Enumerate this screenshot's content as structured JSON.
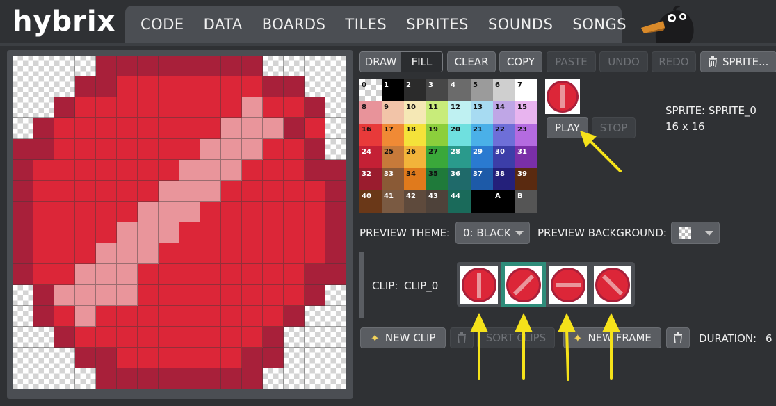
{
  "app": {
    "name": "hybrix"
  },
  "nav": {
    "tabs": [
      "CODE",
      "DATA",
      "BOARDS",
      "TILES",
      "SPRITES",
      "SOUNDS",
      "SONGS"
    ]
  },
  "toolbar": {
    "draw": "DRAW",
    "fill": "FILL",
    "clear": "CLEAR",
    "copy": "COPY",
    "paste": "PASTE",
    "undo": "UNDO",
    "redo": "REDO",
    "sprite_menu": "SPRITE..."
  },
  "palette": {
    "colors": [
      "#000000",
      "#000000",
      "#2b2b2b",
      "#474747",
      "#6b6b6b",
      "#9b9b9b",
      "#cfcfcf",
      "#ffffff",
      "#e8939a",
      "#f2c4a8",
      "#f5e8b5",
      "#c8ec7a",
      "#bff1f2",
      "#a7dbf2",
      "#bfa6e6",
      "#e8b4ef",
      "#e83a3a",
      "#f08a35",
      "#f4e23a",
      "#8ccf3c",
      "#6fe0df",
      "#4ab0e8",
      "#6e6fd8",
      "#b46be0",
      "#c42035",
      "#c77a3a",
      "#f2b43a",
      "#3aa83a",
      "#2a9a8c",
      "#2a7ad0",
      "#3c3ea8",
      "#7a2fa8",
      "#9a1c2e",
      "#8a5a36",
      "#e07a1c",
      "#1f7a3a",
      "#1f6a6a",
      "#1d5aa8",
      "#24207a",
      "#5a2a10",
      "#6a3818",
      "#7a5a42",
      "#5e4a3c",
      "#4e423a",
      "#1a6a5a",
      "#000000",
      "#000000",
      "#3a3a3a"
    ],
    "labels": [
      "0",
      "1",
      "2",
      "3",
      "4",
      "5",
      "6",
      "7",
      "8",
      "9",
      "10",
      "11",
      "12",
      "13",
      "14",
      "15",
      "16",
      "17",
      "18",
      "19",
      "20",
      "21",
      "22",
      "23",
      "24",
      "25",
      "26",
      "27",
      "28",
      "29",
      "30",
      "31",
      "32",
      "33",
      "34",
      "35",
      "36",
      "37",
      "38",
      "39",
      "40",
      "41",
      "42",
      "43",
      "44",
      "",
      "A",
      "B"
    ]
  },
  "sprite": {
    "play": "PLAY",
    "stop": "STOP",
    "name": "SPRITE: SPRITE_0",
    "size": "16 x 16"
  },
  "preview": {
    "theme_label": "PREVIEW THEME:",
    "theme_value": "0: BLACK",
    "background_label": "PREVIEW BACKGROUND:"
  },
  "clip": {
    "label": "CLIP:",
    "name": "CLIP_0",
    "new_clip": "NEW CLIP",
    "sort_clips": "SORT CLIPS",
    "new_frame": "NEW FRAME",
    "duration_label": "DURATION:",
    "duration_value": "6",
    "selected_frame": 1
  },
  "colors": {
    "transparent": "checker",
    "dark_red": "#a8203a",
    "red": "#dc2638",
    "pink": "#e9959b",
    "accent_selected": "#2f8c7a",
    "annotation_arrow": "#f5e21a"
  },
  "canvas": {
    "rows": [
      "TTTTddddddddTTTT",
      "TTTddrrrrrrrddTT",
      "TTdrrrrrrrrprrdT",
      "TdrrrrrrrrpppdrT",
      "ddrrrrrrrppprrdT",
      "drrrrrrrppprrrdd",
      "drrrrrrppprrrrrd",
      "drrrrrppprrrrrrd",
      "drrrrppprrrrrrrd",
      "drrrppprrrrrrrrd",
      "drrppprrrrrrrrdd",
      "TdpppprrrrrrrrdT",
      "TdrprrrrrrrrrdTT",
      "TTdrrrrrrrrrdTTT",
      "TTTddrrrrrrddTTT",
      "TTTTddddddddTTTT"
    ]
  },
  "annotations": {
    "arrows": [
      "play-arrow",
      "frame-0-arrow",
      "frame-1-arrow",
      "frame-2-arrow",
      "frame-3-arrow"
    ]
  }
}
